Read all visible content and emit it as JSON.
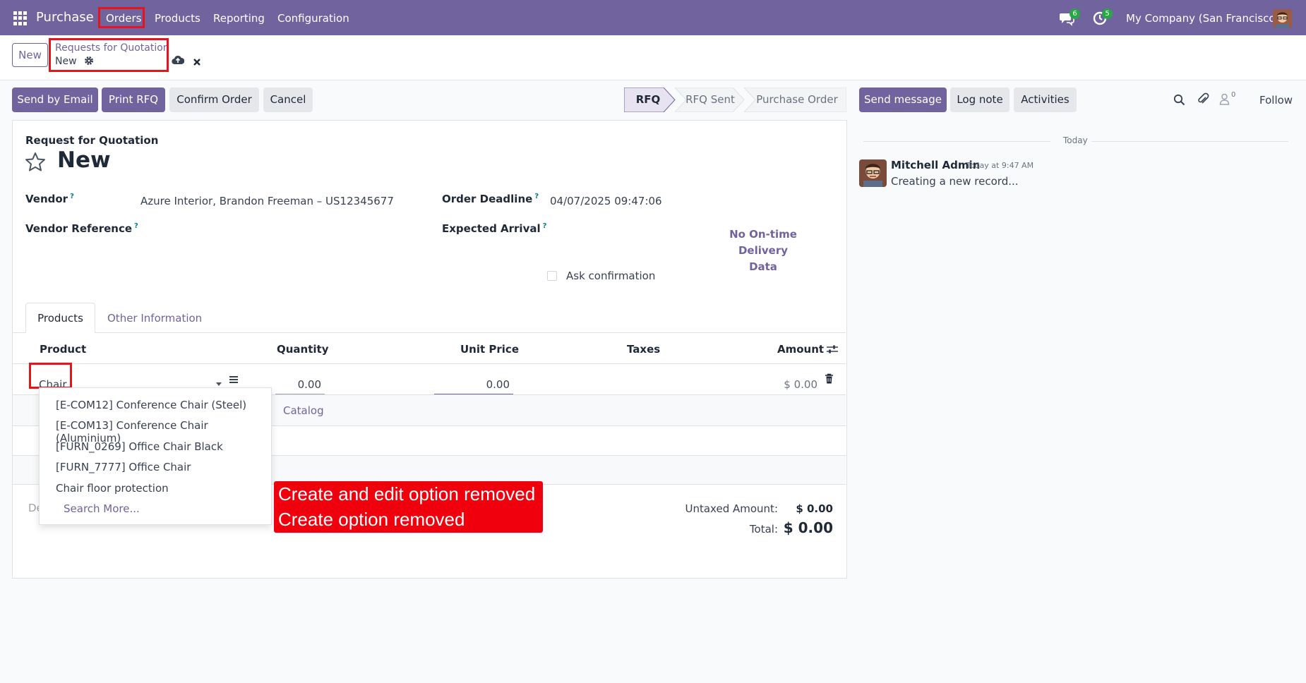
{
  "navbar": {
    "app_name": "Purchase",
    "menus": [
      "Orders",
      "Products",
      "Reporting",
      "Configuration"
    ],
    "messages_badge": "6",
    "activities_badge": "5",
    "company": "My Company (San Francisco)",
    "accent": "#71639e"
  },
  "control_panel": {
    "new_label": "New",
    "breadcrumb_parent": "Requests for Quotation",
    "breadcrumb_current": "New"
  },
  "actions": {
    "send_email": "Send by Email",
    "print_rfq": "Print RFQ",
    "confirm_order": "Confirm Order",
    "cancel": "Cancel"
  },
  "status_stages": [
    "RFQ",
    "RFQ Sent",
    "Purchase Order"
  ],
  "status_active": "RFQ",
  "chatter": {
    "send_message": "Send message",
    "log_note": "Log note",
    "activities": "Activities",
    "follow": "Follow",
    "followers_count": "0",
    "today": "Today",
    "author": "Mitchell Admin",
    "time": "Today at 9:47 AM",
    "message": "Creating a new record..."
  },
  "form": {
    "doc_type": "Request for Quotation",
    "title": "New",
    "vendor_label": "Vendor",
    "vendor_value": "Azure Interior, Brandon Freeman – US12345677",
    "vendor_ref_label": "Vendor Reference",
    "order_deadline_label": "Order Deadline",
    "order_deadline_value": "04/07/2025 09:47:06",
    "expected_arrival_label": "Expected Arrival",
    "on_time_line1": "No On-time Delivery",
    "on_time_line2": "Data",
    "ask_confirmation_label": "Ask confirmation",
    "help_mark": "?"
  },
  "tabs": [
    "Products",
    "Other Information"
  ],
  "table": {
    "headers": {
      "product": "Product",
      "quantity": "Quantity",
      "unit_price": "Unit Price",
      "taxes": "Taxes",
      "amount": "Amount"
    },
    "row": {
      "product": "Chair",
      "quantity": "0.00",
      "unit_price": "0.00",
      "amount": "$ 0.00"
    },
    "catalog_label": "Catalog",
    "partial_text": "De"
  },
  "dropdown": {
    "items": [
      "[E-COM12] Conference Chair (Steel)",
      "[E-COM13] Conference Chair (Aluminium)",
      "[FURN_0269] Office Chair Black",
      "[FURN_7777] Office Chair",
      "Chair floor protection"
    ],
    "search_more": "Search More..."
  },
  "totals": {
    "untaxed_label": "Untaxed Amount:",
    "untaxed_value": "$ 0.00",
    "total_label": "Total:",
    "total_value": "$ 0.00"
  },
  "annotation": {
    "line1": "Create and edit option removed",
    "line2": "Create option removed"
  }
}
